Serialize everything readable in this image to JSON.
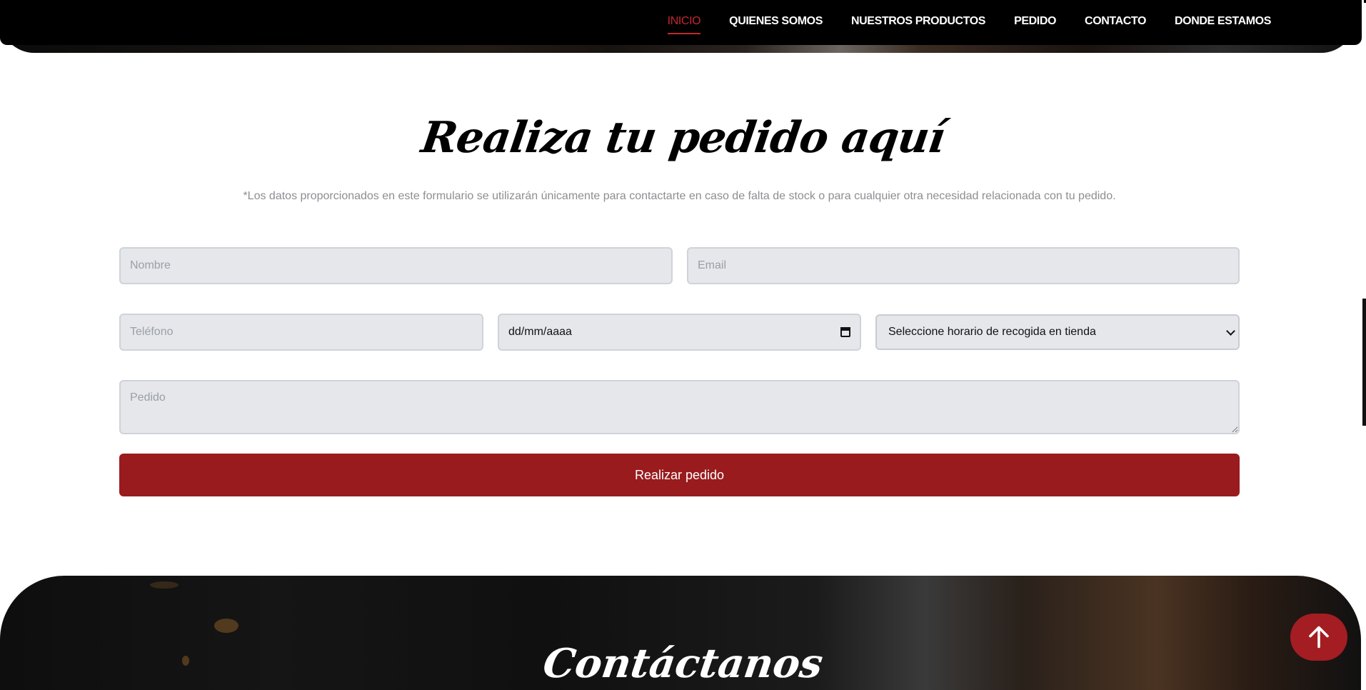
{
  "nav": {
    "items": [
      {
        "label": "INICIO",
        "active": true
      },
      {
        "label": "QUIENES SOMOS"
      },
      {
        "label": "NUESTROS PRODUCTOS"
      },
      {
        "label": "PEDIDO"
      },
      {
        "label": "CONTACTO"
      },
      {
        "label": "DONDE ESTAMOS"
      }
    ],
    "active_color": "#c1272d"
  },
  "order_section": {
    "title": "Realiza tu pedido aquí",
    "disclaimer": "*Los datos proporcionados en este formulario se utilizarán únicamente para contactarte en caso de falta de stock o para cualquier otra necesidad relacionada con tu pedido.",
    "form": {
      "name_placeholder": "Nombre",
      "email_placeholder": "Email",
      "phone_placeholder": "Teléfono",
      "date_value": "dd/mm/aaaa",
      "pickup_select_value": "Seleccione horario de recogida en tienda",
      "order_placeholder": "Pedido",
      "submit_label": "Realizar pedido"
    },
    "button_color": "#991b1e"
  },
  "contact_section": {
    "title": "Contáctanos"
  },
  "scroll_top": {
    "icon": "arrow-up-icon"
  }
}
